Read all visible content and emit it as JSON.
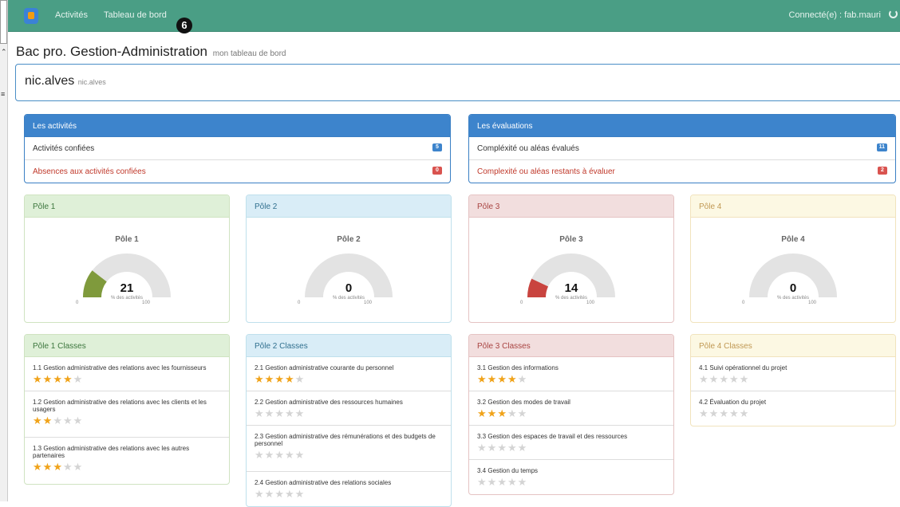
{
  "nav": {
    "activities": "Activités",
    "dashboard": "Tableau de bord",
    "badge": "6",
    "user": "Connecté(e) : fab.mauri"
  },
  "page": {
    "title": "Bac pro. Gestion-Administration",
    "subtitle": "mon tableau de bord"
  },
  "user_box": {
    "name": "nic.alves",
    "login": "nic.alves"
  },
  "activities_panel": {
    "title": "Les activités",
    "rows": [
      {
        "label": "Activités confiées",
        "count": "5"
      },
      {
        "label": "Absences aux activités confiées",
        "count": "0"
      }
    ]
  },
  "evaluations_panel": {
    "title": "Les évaluations",
    "rows": [
      {
        "label": "Compléxité ou aléas évalués",
        "count": "11"
      },
      {
        "label": "Complexité ou aléas restants à évaluer",
        "count": "2"
      }
    ]
  },
  "poles": [
    {
      "header": "Pôle 1",
      "gauge_title": "Pôle 1",
      "value": 21,
      "color": "#7f9a3c",
      "min": "0",
      "max": "100",
      "unit": "% des activités"
    },
    {
      "header": "Pôle 2",
      "gauge_title": "Pôle 2",
      "value": 0,
      "color": "#3d84cc",
      "min": "0",
      "max": "100",
      "unit": "% des activités"
    },
    {
      "header": "Pôle 3",
      "gauge_title": "Pôle 3",
      "value": 14,
      "color": "#c9443f",
      "min": "0",
      "max": "100",
      "unit": "% des activités"
    },
    {
      "header": "Pôle 4",
      "gauge_title": "Pôle 4",
      "value": 0,
      "color": "#c09853",
      "min": "0",
      "max": "100",
      "unit": "% des activités"
    }
  ],
  "classes": [
    {
      "header": "Pôle 1 Classes",
      "items": [
        {
          "label": "1.1 Gestion administrative des relations avec les fournisseurs",
          "stars": 4
        },
        {
          "label": "1.2 Gestion administrative des relations avec les clients et les usagers",
          "stars": 2
        },
        {
          "label": "1.3 Gestion administrative des relations avec les autres partenaires",
          "stars": 3
        }
      ]
    },
    {
      "header": "Pôle 2 Classes",
      "items": [
        {
          "label": "2.1 Gestion administrative courante du personnel",
          "stars": 4
        },
        {
          "label": "2.2 Gestion administrative des ressources humaines",
          "stars": 0
        },
        {
          "label": "2.3 Gestion administrative des rémunérations et des budgets de personnel",
          "stars": 0
        },
        {
          "label": "2.4 Gestion administrative des relations sociales",
          "stars": 0
        }
      ]
    },
    {
      "header": "Pôle 3 Classes",
      "items": [
        {
          "label": "3.1 Gestion des informations",
          "stars": 4
        },
        {
          "label": "3.2 Gestion des modes de travail",
          "stars": 3
        },
        {
          "label": "3.3 Gestion des espaces de travail et des ressources",
          "stars": 0
        },
        {
          "label": "3.4 Gestion du temps",
          "stars": 0
        }
      ]
    },
    {
      "header": "Pôle 4 Classes",
      "items": [
        {
          "label": "4.1 Suivi opérationnel du projet",
          "stars": 0
        },
        {
          "label": "4.2 Évaluation du projet",
          "stars": 0
        }
      ]
    }
  ]
}
